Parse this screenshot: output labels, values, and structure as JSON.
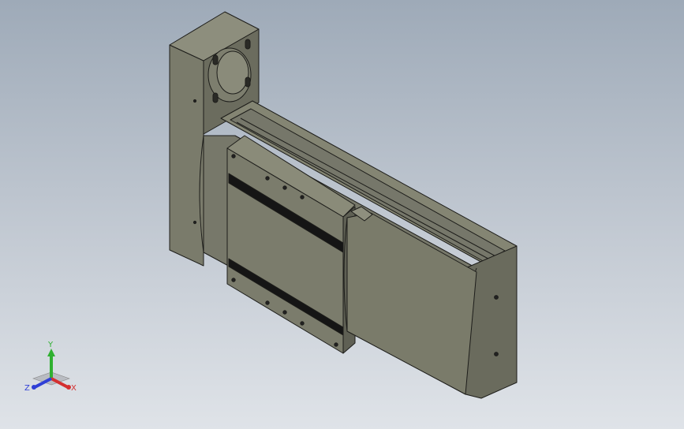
{
  "viewport": {
    "background_top": "#9eaab8",
    "background_bottom": "#dfe3e8",
    "model_colors": {
      "face_light": "#7d7e6d",
      "face_mid": "#6e6f60",
      "face_dark": "#5e5f53",
      "edge": "#1d1d1a",
      "slot": "#151515"
    }
  },
  "triad": {
    "x_label": "X",
    "y_label": "Y",
    "z_label": "Z",
    "x_color": "#d43030",
    "y_color": "#2fb030",
    "z_color": "#2f3fd6"
  }
}
